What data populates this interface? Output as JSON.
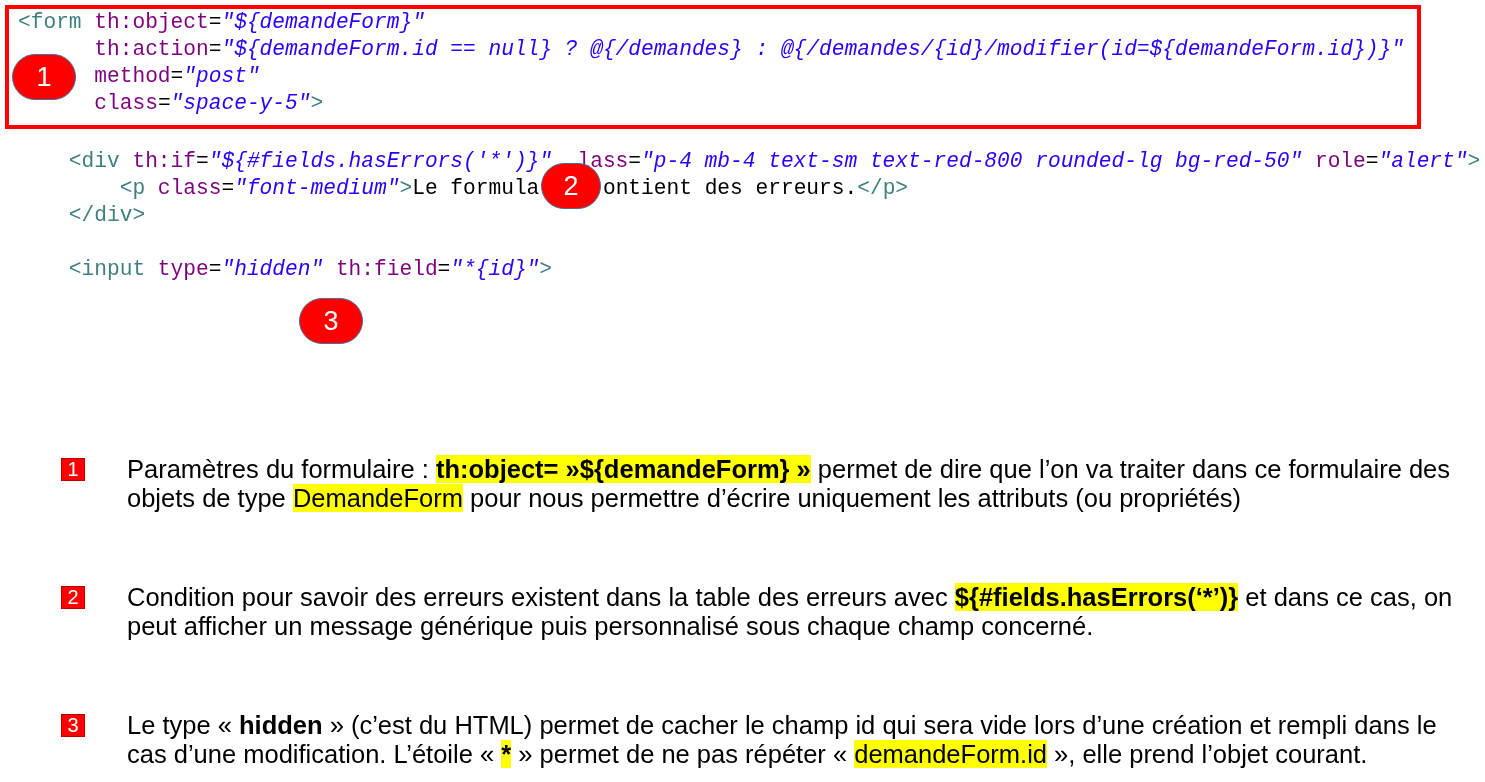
{
  "form_code": [
    [
      [
        {
          "kind": "tag",
          "text": "<form"
        },
        {
          "kind": "attr",
          "text": " th:object"
        },
        {
          "kind": "punct",
          "text": "="
        },
        {
          "kind": "value",
          "text": "\"${demandeForm}\""
        }
      ]
    ],
    [
      [
        {
          "kind": "attr",
          "text": "      th:action"
        },
        {
          "kind": "punct",
          "text": "="
        },
        {
          "kind": "value",
          "text": "\"${demandeForm.id == null} ? @{/demandes} : @{/demandes/{id}/modifier(id=${demandeForm.id})}\""
        }
      ]
    ],
    [
      [
        {
          "kind": "attr",
          "text": "      method"
        },
        {
          "kind": "punct",
          "text": "="
        },
        {
          "kind": "value",
          "text": "\"post\""
        }
      ]
    ],
    [
      [
        {
          "kind": "attr",
          "text": "      class"
        },
        {
          "kind": "punct",
          "text": "="
        },
        {
          "kind": "value",
          "text": "\"space-y-5\""
        },
        {
          "kind": "tag",
          "text": ">"
        }
      ]
    ]
  ],
  "code_blocks": [
    [
      [
        [
          {
            "kind": "tag",
            "text": "    <div"
          },
          {
            "kind": "attr",
            "text": " th:if"
          },
          {
            "kind": "punct",
            "text": "="
          },
          {
            "kind": "value",
            "text": "\"${#fields.hasErrors('*')}\""
          }
        ],
        [
          {
            "kind": "attr",
            "text": "  lass"
          },
          {
            "kind": "punct",
            "text": "="
          },
          {
            "kind": "value",
            "text": "\"p-4 mb-4 text-sm text-red-800 rounded-lg bg-red-50\""
          },
          {
            "kind": "attr",
            "text": " role"
          },
          {
            "kind": "punct",
            "text": "="
          },
          {
            "kind": "value",
            "text": "\"alert\""
          },
          {
            "kind": "tag",
            "text": ">"
          }
        ]
      ],
      [
        [
          {
            "kind": "tag",
            "text": "        <p"
          },
          {
            "kind": "attr",
            "text": " class"
          },
          {
            "kind": "punct",
            "text": "="
          },
          {
            "kind": "value",
            "text": "\"font-medium\""
          },
          {
            "kind": "tag",
            "text": ">"
          },
          {
            "kind": "text",
            "text": "Le formula"
          }
        ],
        [
          {
            "kind": "text",
            "text": "     ontient des erreurs."
          },
          {
            "kind": "tag",
            "text": "</p>"
          }
        ]
      ],
      [
        [
          {
            "kind": "tag",
            "text": "    </div>"
          }
        ]
      ]
    ],
    [
      [
        [
          {
            "kind": "tag",
            "text": "    <input"
          },
          {
            "kind": "attr",
            "text": " type"
          },
          {
            "kind": "punct",
            "text": "="
          },
          {
            "kind": "value",
            "text": "\"hidden\""
          },
          {
            "kind": "attr",
            "text": " th:field"
          },
          {
            "kind": "punct",
            "text": "="
          },
          {
            "kind": "value",
            "text": "\"*{id}\""
          },
          {
            "kind": "tag",
            "text": ">"
          }
        ]
      ]
    ]
  ],
  "callouts": [
    "1",
    "2",
    "3"
  ],
  "notes": [
    {
      "number": "1",
      "segments": [
        {
          "text": "Paramètres du formulaire : ",
          "bold": false,
          "highlight": false
        },
        {
          "text": "th:object= »${demandeForm} »",
          "bold": true,
          "highlight": true
        },
        {
          "text": " permet de dire que l’on va traiter dans ce formulaire des objets de type ",
          "bold": false,
          "highlight": false
        },
        {
          "text": "DemandeForm",
          "bold": false,
          "highlight": true
        },
        {
          "text": " pour nous permettre d’écrire uniquement les attributs (ou propriétés)",
          "bold": false,
          "highlight": false
        }
      ]
    },
    {
      "number": "2",
      "segments": [
        {
          "text": "Condition pour savoir des erreurs existent dans la table des erreurs avec ",
          "bold": false,
          "highlight": false
        },
        {
          "text": "${#fields.hasErrors(‘*’)}",
          "bold": true,
          "highlight": true
        },
        {
          "text": " et dans ce cas, on peut afficher un message générique puis personnalisé sous chaque champ concerné.",
          "bold": false,
          "highlight": false
        }
      ]
    },
    {
      "number": "3",
      "segments": [
        {
          "text": "Le type « ",
          "bold": false,
          "highlight": false
        },
        {
          "text": "hidden",
          "bold": true,
          "highlight": false
        },
        {
          "text": " » (c’est du HTML) permet de cacher le champ id qui sera vide lors d’une création et rempli dans le cas d’une modification. L’étoile « ",
          "bold": false,
          "highlight": false
        },
        {
          "text": "*",
          "bold": true,
          "highlight": true
        },
        {
          "text": " » permet de ne pas répéter « ",
          "bold": false,
          "highlight": false
        },
        {
          "text": "demandeForm.id",
          "bold": false,
          "highlight": true
        },
        {
          "text": " », elle prend l’objet courant.",
          "bold": false,
          "highlight": false
        }
      ]
    }
  ]
}
